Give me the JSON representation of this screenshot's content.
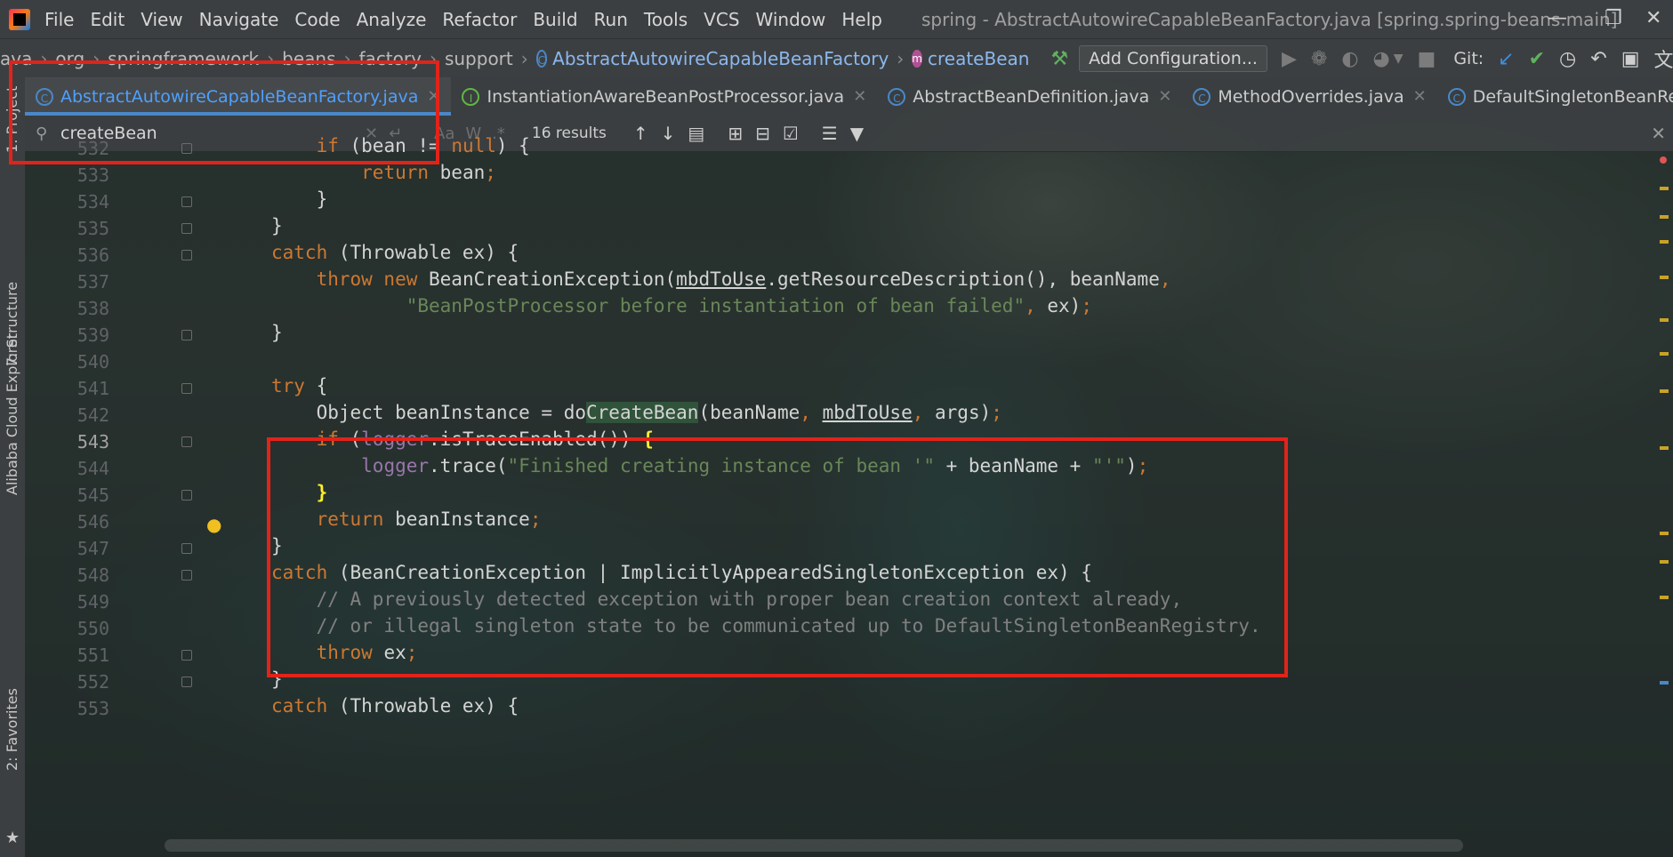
{
  "menu": {
    "items": [
      "File",
      "Edit",
      "View",
      "Navigate",
      "Code",
      "Analyze",
      "Refactor",
      "Build",
      "Run",
      "Tools",
      "VCS",
      "Window",
      "Help"
    ],
    "window_title": "spring - AbstractAutowireCapableBeanFactory.java [spring.spring-beans.main]"
  },
  "breadcrumbs": {
    "items": [
      "ava",
      "org",
      "springframework",
      "beans",
      "factory",
      "support"
    ],
    "class_name": "AbstractAutowireCapableBeanFactory",
    "method_name": "createBean",
    "class_badge": "C",
    "method_badge": "m"
  },
  "toolbar": {
    "add_configuration": "Add Configuration...",
    "git_label": "Git:"
  },
  "side_tabs": {
    "project": "1: Project",
    "structure": "7: Structure",
    "cloud": "Alibaba Cloud Explorer",
    "favorites": "2: Favorites"
  },
  "tabs": [
    {
      "label": "AbstractAutowireCapableBeanFactory.java"
    },
    {
      "label": "InstantiationAwareBeanPostProcessor.java"
    },
    {
      "label": "AbstractBeanDefinition.java"
    },
    {
      "label": "MethodOverrides.java"
    },
    {
      "label": "DefaultSingletonBeanRegistry.java"
    }
  ],
  "search": {
    "query": "createBean",
    "results": "16 results",
    "match_case": "Aa",
    "whole_words": "W",
    "regex": ".*"
  },
  "editor": {
    "line_numbers": [
      "532",
      "533",
      "534",
      "535",
      "536",
      "537",
      "538",
      "539",
      "540",
      "541",
      "542",
      "543",
      "544",
      "545",
      "546",
      "547",
      "548",
      "549",
      "550",
      "551",
      "552",
      "553"
    ],
    "current_line": "543"
  },
  "colors": {
    "keyword": "#cc7832",
    "string": "#6a8759",
    "comment": "#808080",
    "field": "#9876aa",
    "highlight_box": "#e2231a",
    "active_tab": "#4ea0ff"
  }
}
